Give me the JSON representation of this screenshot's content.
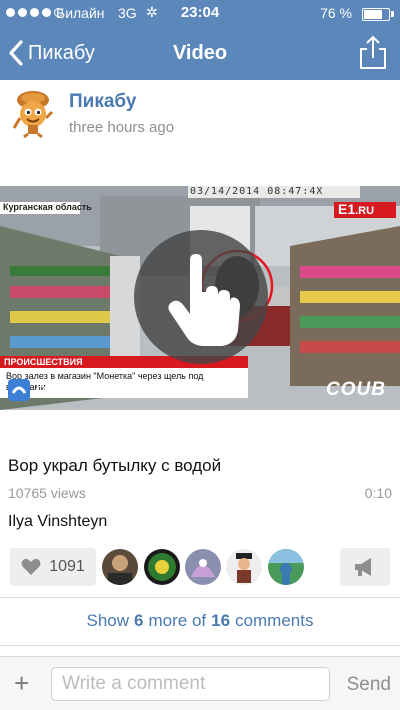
{
  "status_bar": {
    "signal_full": 4,
    "signal_total": 5,
    "carrier": "Билайн",
    "network": "3G",
    "time": "23:04",
    "battery_text": "76 %",
    "battery_level": 0.76
  },
  "nav": {
    "back_label": "Пикабу",
    "title": "Video",
    "share_icon": "share-icon"
  },
  "post": {
    "author": "Пикабу",
    "time_ago": "three hours ago"
  },
  "video": {
    "region_label": "Курганская область",
    "brand_e1": "E1",
    "brand_ru": ".RU",
    "date_text": "03/14/2014 08:47:4X",
    "ticker_band": "ПРОИСШЕСТВИЯ",
    "ticker_text": "Вор залез в магазин \"Монетка\" через щель под воротами",
    "open_in_app": "Open in App",
    "coub_logo": "COUB",
    "play_icon": "tap-hand-icon"
  },
  "meta": {
    "title": "Вор украл бутылку с водой",
    "views": "10765 views",
    "duration": "0:10",
    "uploader": "Ilya Vinshteyn"
  },
  "likes": {
    "count": "1091",
    "icon": "heart-icon"
  },
  "likers": [
    {
      "name": "liker-avatar-1"
    },
    {
      "name": "liker-avatar-2"
    },
    {
      "name": "liker-avatar-3"
    },
    {
      "name": "liker-avatar-4"
    },
    {
      "name": "liker-avatar-5"
    }
  ],
  "comments": {
    "show_prefix": "Show",
    "shown": "6",
    "mid": "more of",
    "total": "16",
    "suffix": "comments"
  },
  "composer": {
    "placeholder": "Write a comment",
    "send_label": "Send"
  },
  "colors": {
    "nav_bar": "#5b87bb",
    "link": "#4a7ab0",
    "news_red": "#d71920"
  }
}
